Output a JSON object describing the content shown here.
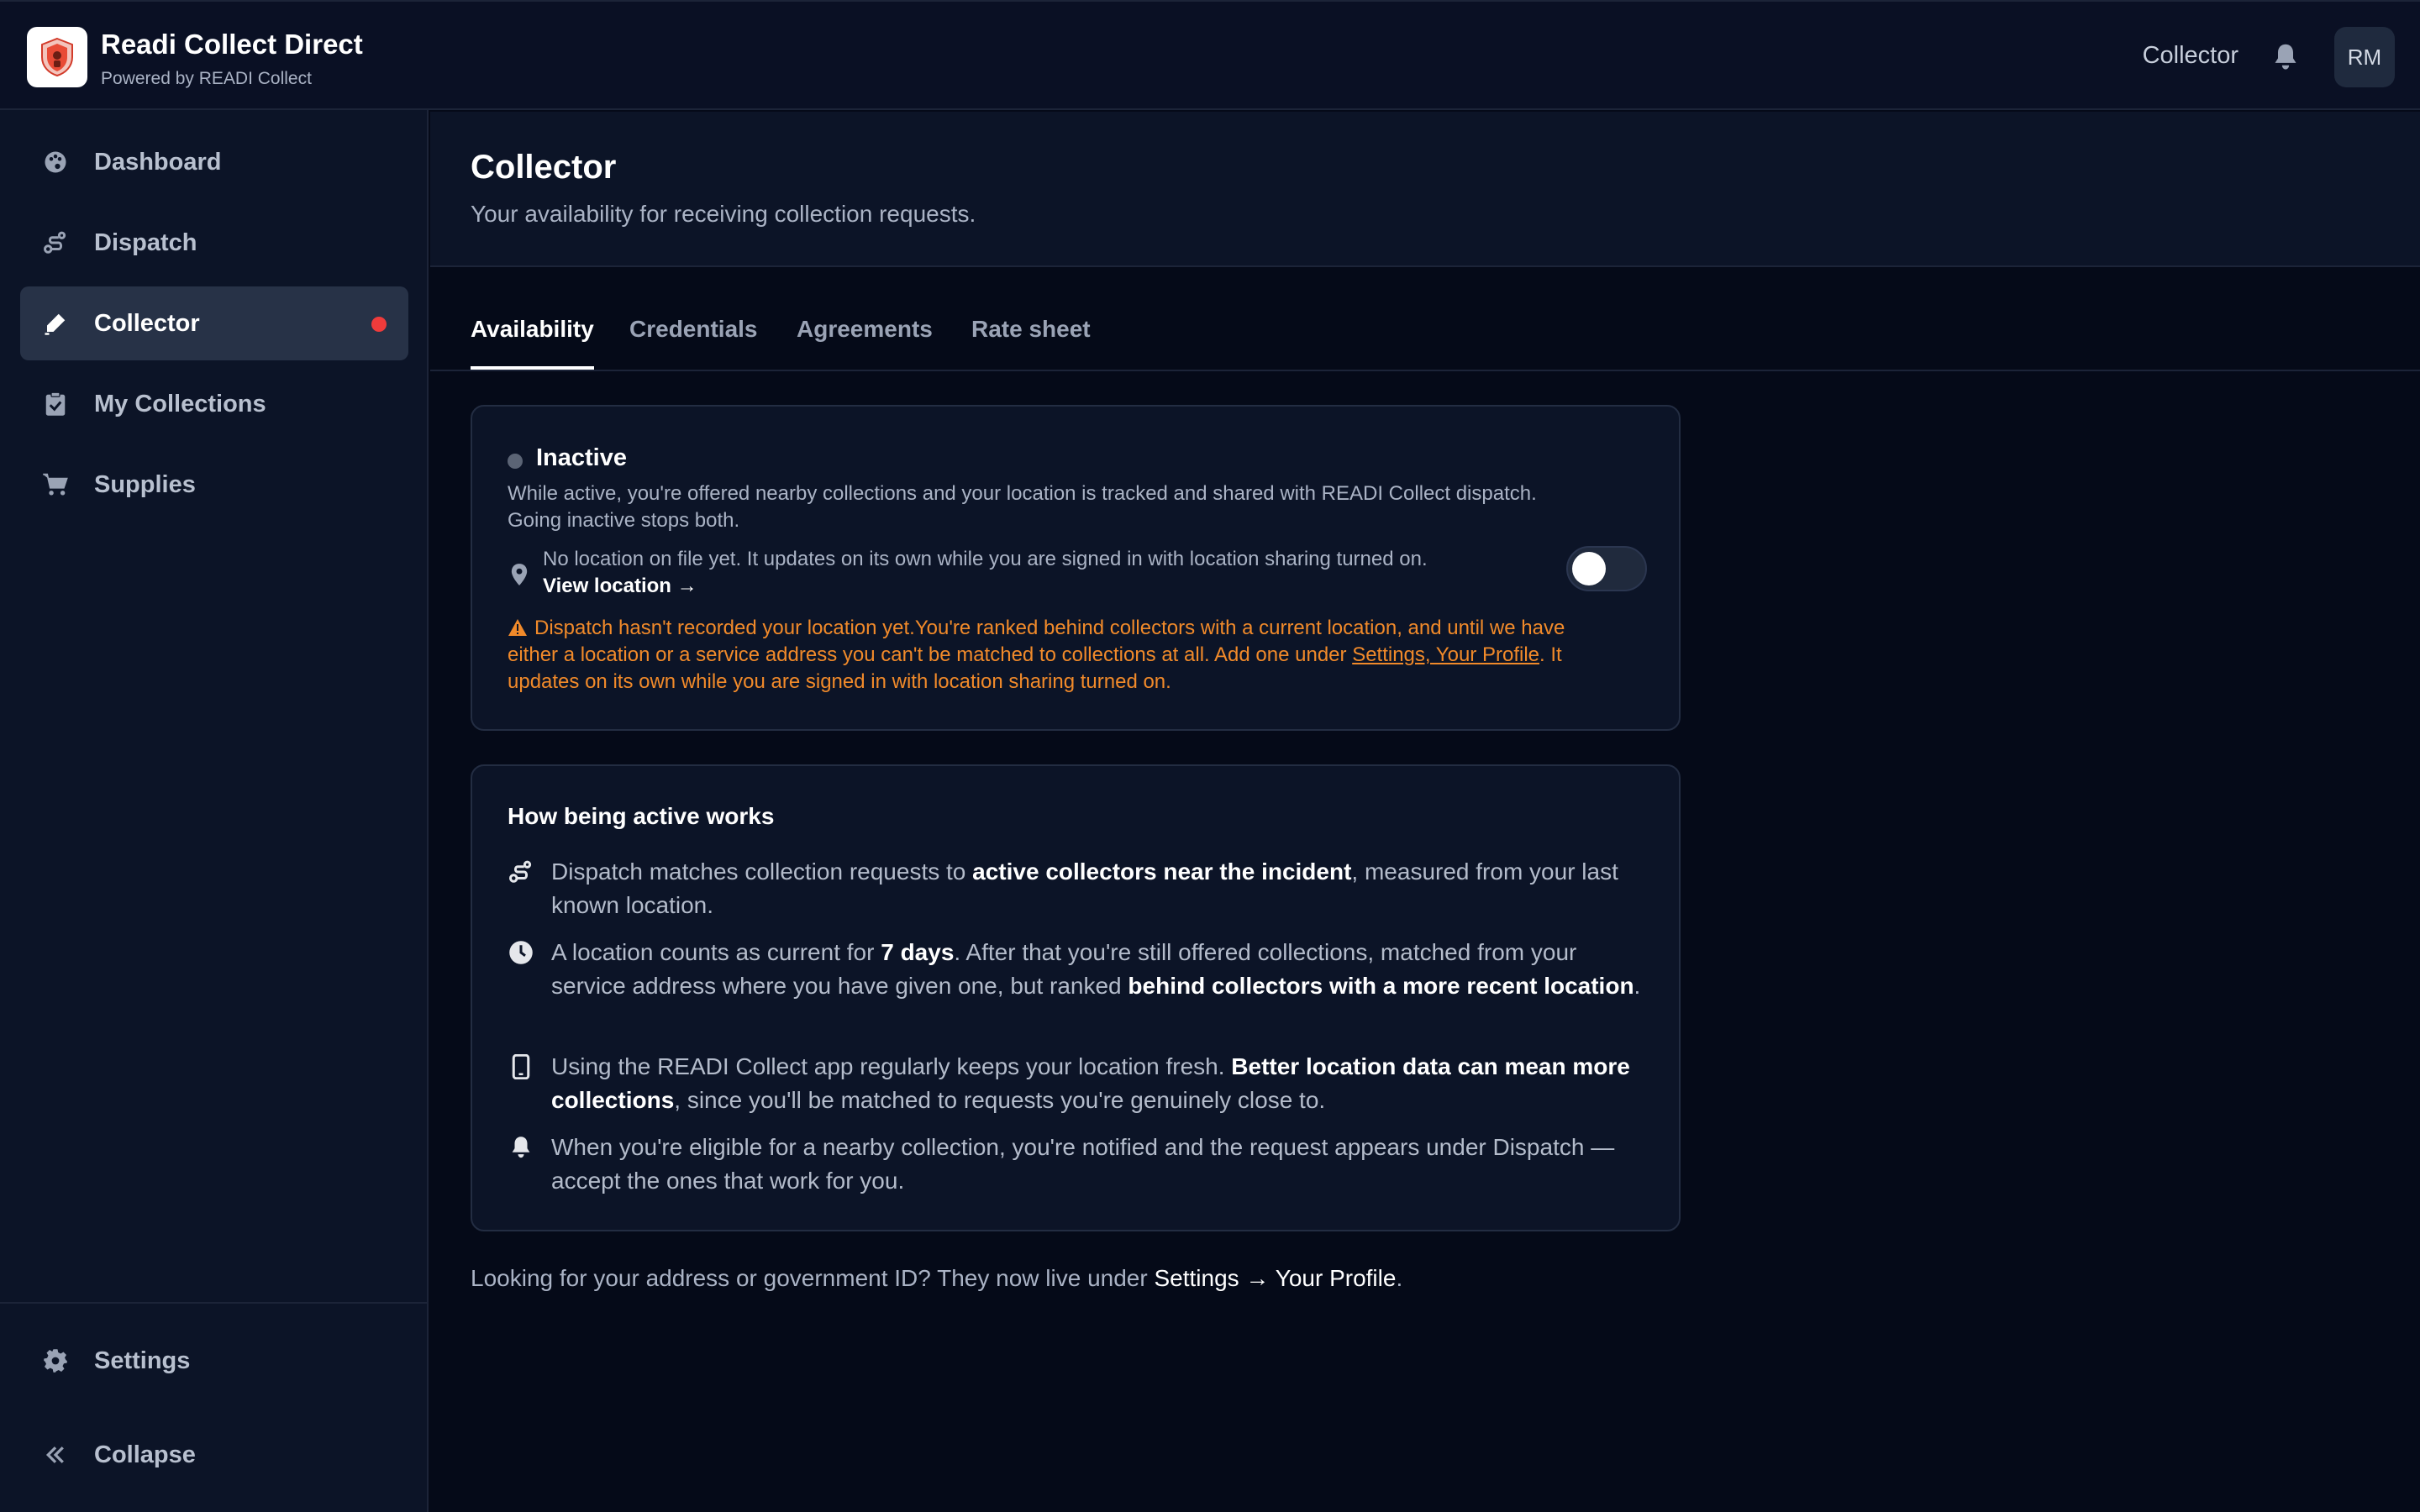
{
  "header": {
    "app_title": "Readi Collect Direct",
    "app_subtitle": "Powered by READI Collect",
    "role": "Collector",
    "avatar_initials": "RM"
  },
  "sidebar": {
    "items": [
      {
        "label": "Dashboard",
        "icon": "palette-icon"
      },
      {
        "label": "Dispatch",
        "icon": "route-icon"
      },
      {
        "label": "Collector",
        "icon": "pen-icon",
        "active": true,
        "badge_color": "#ef3b3b"
      },
      {
        "label": "My Collections",
        "icon": "clipboard-check-icon"
      },
      {
        "label": "Supplies",
        "icon": "cart-icon"
      }
    ],
    "settings_label": "Settings",
    "collapse_label": "Collapse"
  },
  "page": {
    "title": "Collector",
    "description": "Your availability for receiving collection requests."
  },
  "tabs": [
    "Availability",
    "Credentials",
    "Agreements",
    "Rate sheet"
  ],
  "status_card": {
    "status": "Inactive",
    "toggle_on": false,
    "description": "While active, you're offered nearby collections and your location is tracked and shared with READI Collect dispatch. Going inactive stops both.",
    "location_text": "No location on file yet. It updates on its own while you are signed in with location sharing turned on.",
    "location_link": "View location →",
    "warning_text": "Dispatch hasn't recorded your location yet.You're ranked behind collectors with a current location, and until we have either a location or a service address you can't be matched to collections at all. Add one under",
    "warning_link": "Settings, Your Profile",
    "warning_text_after": ". It updates on its own while you are signed in with location sharing turned on."
  },
  "how_card": {
    "title": "How being active works",
    "items": [
      {
        "icon": "route-icon",
        "pre": "Dispatch matches collection requests to ",
        "bold": "active collectors near the incident",
        "post": ", measured from your last known location.",
        "bold2": "",
        "post2": ""
      },
      {
        "icon": "clock-icon",
        "pre": "A location counts as current for ",
        "bold": "7 days",
        "post": ". After that you're still offered collections, matched from your service address where you have given one, but ranked ",
        "bold2": "behind collectors with a more recent location",
        "post2": "."
      },
      {
        "icon": "phone-icon",
        "pre": "Using the READI Collect app regularly keeps your location fresh. ",
        "bold": "Better location data can mean more collections",
        "post": ", since you'll be matched to requests you're genuinely close to.",
        "bold2": "",
        "post2": ""
      },
      {
        "icon": "bell-icon",
        "pre": "When you're eligible for a nearby collection, you're notified and the request appears under Dispatch — accept the ones that work for you.",
        "bold": "",
        "post": "",
        "bold2": "",
        "post2": ""
      }
    ]
  },
  "footer_note": {
    "pre": "Looking for your address or government ID? They now live under ",
    "link": "Settings → Your Profile",
    "post": "."
  },
  "colors": {
    "accent_red": "#ef3b3b",
    "warning_orange": "#f18a2a",
    "background": "#050a18"
  }
}
